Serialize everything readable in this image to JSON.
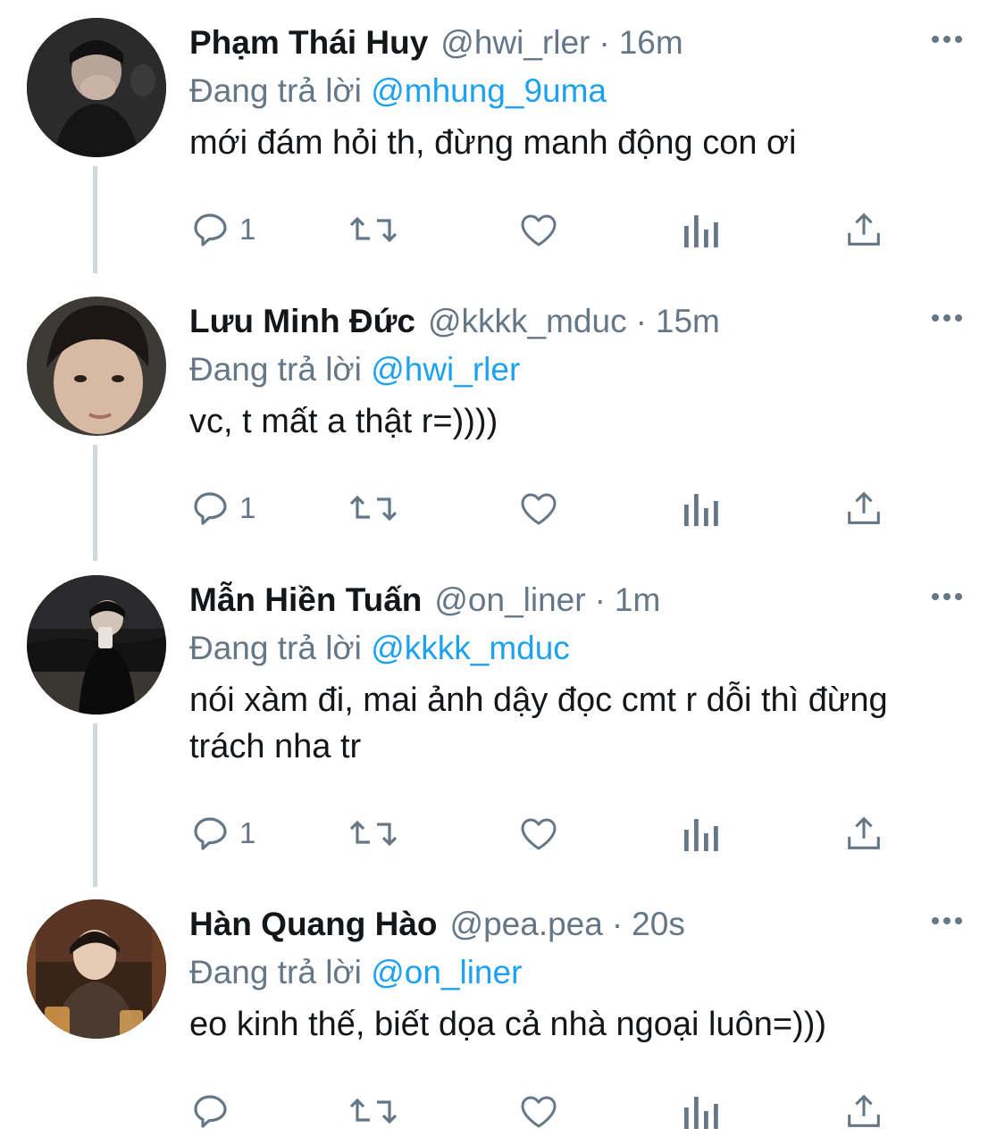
{
  "theme": {
    "text": "#14171a",
    "muted": "#657786",
    "link": "#1da1f2",
    "icon": "#657786",
    "thread_line": "#cfd9de"
  },
  "tweets": [
    {
      "name": "Phạm Thái Huy",
      "handle": "@hwi_rler",
      "separator": "·",
      "time": "16m",
      "replying_prefix": "Đang trả lời",
      "replying_to": "@mhung_9uma",
      "text": "mới đám hỏi th, đừng manh động con ơi",
      "reply_count": "1",
      "avatar": "avatar-photo-dark-hand-over-face"
    },
    {
      "name": "Lưu Minh Đức",
      "handle": "@kkkk_mduc",
      "separator": "·",
      "time": "15m",
      "replying_prefix": "Đang trả lời",
      "replying_to": "@hwi_rler",
      "text": "vc, t mất a thật r=))))",
      "reply_count": "1",
      "avatar": "avatar-photo-face-closeup"
    },
    {
      "name": "Mẫn Hiền Tuấn",
      "handle": "@on_liner",
      "separator": "·",
      "time": "1m",
      "replying_prefix": "Đang trả lời",
      "replying_to": "@kkkk_mduc",
      "text": "nói xàm đi, mai ảnh dậy đọc cmt r dỗi thì đừng trách nha tr",
      "reply_count": "1",
      "avatar": "avatar-photo-night-mirror-selfie"
    },
    {
      "name": "Hàn Quang Hào",
      "handle": "@pea.pea",
      "separator": "·",
      "time": "20s",
      "replying_prefix": "Đang trả lời",
      "replying_to": "@on_liner",
      "text": "eo kinh thế, biết dọa cả nhà ngoại luôn=)))",
      "reply_count": "",
      "avatar": "avatar-photo-restaurant-warm"
    }
  ],
  "icons": [
    "reply-icon",
    "retweet-icon",
    "like-icon",
    "analytics-icon",
    "share-icon",
    "more-icon"
  ]
}
